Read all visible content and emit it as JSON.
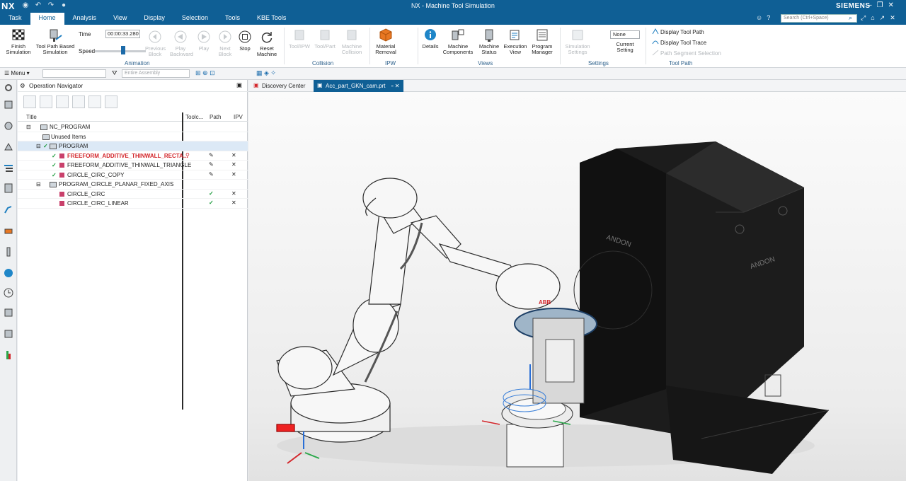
{
  "app": {
    "logo": "NX",
    "title": "NX - Machine Tool Simulation",
    "brand": "SIEMENS",
    "search_placeholder": "Search (Ctrl+Space)"
  },
  "menu_tabs": [
    "Task",
    "Home",
    "Analysis",
    "View",
    "Display",
    "Selection",
    "Tools",
    "KBE Tools"
  ],
  "active_tab": "Home",
  "ribbon": {
    "animation": {
      "finish": "Finish Simulation",
      "tool_path": "Tool Path Based Simulation",
      "time_label": "Time",
      "time_value": "00:00:33.280",
      "speed_label": "Speed",
      "speed_fraction": 0.55,
      "previous_block": "Previous Block",
      "play_backward": "Play Backward",
      "play": "Play",
      "next_block": "Next Block",
      "stop": "Stop",
      "reset": "Reset Machine",
      "label": "Animation"
    },
    "collision": {
      "tool_ipw": "Tool/IPW",
      "tool_part": "Tool/Part",
      "machine_collision": "Machine Collision",
      "label": "Collision"
    },
    "ipw": {
      "material_removal": "Material Removal",
      "label": "IPW"
    },
    "views": {
      "details": "Details",
      "machine_components": "Machine Components",
      "machine_status": "Machine Status",
      "execution_view": "Execution View",
      "program_manager": "Program Manager",
      "label": "Views"
    },
    "settings": {
      "simulation_settings": "Simulation Settings",
      "none_value": "None",
      "current_setting": "Current Setting",
      "label": "Settings"
    },
    "toolpath": {
      "display_tool_path": "Display Tool Path",
      "display_tool_trace": "Display Tool Trace",
      "path_segment_selection": "Path Segment Selection",
      "label": "Tool Path"
    }
  },
  "toolbar2": {
    "menu_label": "Menu",
    "assembly_placeholder": "Entire Assembly"
  },
  "navigator": {
    "title": "Operation Navigator",
    "columns": [
      "Title",
      "Toolc...",
      "Path",
      "IPV"
    ],
    "rows": [
      {
        "label": "NC_PROGRAM",
        "level": 0
      },
      {
        "label": "Unused Items",
        "level": 1
      },
      {
        "label": "PROGRAM",
        "level": 1
      },
      {
        "label": "FREEFORM_ADDITIVE_THINWALL_RECTA...",
        "level": 2
      },
      {
        "label": "FREEFORM_ADDITIVE_THINWALL_TRIANGLE",
        "level": 2
      },
      {
        "label": "CIRCLE_CIRC_COPY",
        "level": 2
      },
      {
        "label": "PROGRAM_CIRCLE_PLANAR_FIXED_AXIS",
        "level": 1
      },
      {
        "label": "CIRCLE_CIRC",
        "level": 2
      },
      {
        "label": "CIRCLE_CIRC_LINEAR",
        "level": 2
      }
    ]
  },
  "doc_tabs": [
    "Discovery Center",
    "Acc_part_GKN_cam.prt"
  ],
  "viewport": {
    "robot_brand": "ABB",
    "cell_brand": "ANDON"
  }
}
